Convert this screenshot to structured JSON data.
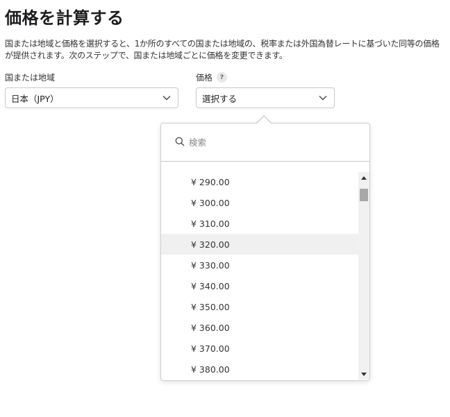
{
  "page": {
    "title": "価格を計算する",
    "description": "国または地域と価格を選択すると、1か所のすべての国または地域の、税率または外国為替レートに基づいた同等の価格が提供されます。次のステップで、国または地域ごとに価格を変更できます。"
  },
  "region_field": {
    "label": "国または地域",
    "value": "日本（JPY）"
  },
  "price_field": {
    "label": "価格",
    "help_glyph": "?",
    "value": "選択する"
  },
  "dropdown": {
    "search_placeholder": "検索",
    "items": [
      {
        "label": "¥ 290.00",
        "highlighted": false
      },
      {
        "label": "¥ 300.00",
        "highlighted": false
      },
      {
        "label": "¥ 310.00",
        "highlighted": false
      },
      {
        "label": "¥ 320.00",
        "highlighted": true
      },
      {
        "label": "¥ 330.00",
        "highlighted": false
      },
      {
        "label": "¥ 340.00",
        "highlighted": false
      },
      {
        "label": "¥ 350.00",
        "highlighted": false
      },
      {
        "label": "¥ 360.00",
        "highlighted": false
      },
      {
        "label": "¥ 370.00",
        "highlighted": false
      },
      {
        "label": "¥ 380.00",
        "highlighted": false
      }
    ]
  },
  "icons": {
    "dropdown_chevron": "chevron-down-icon",
    "search": "search-icon",
    "scroll_up": "scroll-up-arrow-icon",
    "scroll_down": "scroll-down-arrow-icon"
  },
  "colors": {
    "highlight_row": "#f0f0f0",
    "border": "#c8c8cc"
  }
}
